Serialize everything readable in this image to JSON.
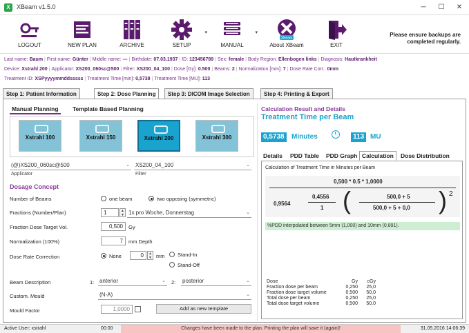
{
  "window": {
    "title": "XBeam v1.5.0",
    "app_icon": "X",
    "minimize": "─",
    "maximize": "☐",
    "close": "✕"
  },
  "toolbar": {
    "items": [
      {
        "label": "LOGOUT",
        "icon": "key-icon"
      },
      {
        "label": "NEW PLAN",
        "icon": "new-plan-icon"
      },
      {
        "label": "ARCHIVE",
        "icon": "archive-icon"
      },
      {
        "label": "SETUP",
        "icon": "gear-icon"
      },
      {
        "label": "MANUAL",
        "icon": "book-icon"
      },
      {
        "label": "About XBeam",
        "icon": "xbeam-logo-icon",
        "logo_text": "XBeam"
      },
      {
        "label": "EXIT",
        "icon": "exit-icon"
      }
    ],
    "backup_note": "Please ensure backups are completed regularly."
  },
  "patient_info": {
    "row1": [
      {
        "k": "Last name:",
        "v": "Baum"
      },
      {
        "k": "First name:",
        "v": "Günter"
      },
      {
        "k": "Middle name:",
        "v": "---"
      },
      {
        "k": "Birthdate:",
        "v": "07.03.1937"
      },
      {
        "k": "ID:",
        "v": "123456789"
      },
      {
        "k": "Sex:",
        "v": "female"
      },
      {
        "k": "Body Region:",
        "v": "Ellenbogen links"
      },
      {
        "k": "Diagnosis:",
        "v": "Hautkrankheit"
      }
    ],
    "row2": [
      {
        "k": "Device:",
        "v": "Xstrahl 200"
      },
      {
        "k": "Applicator:",
        "v": "XS200_060sc@500"
      },
      {
        "k": "Filter:",
        "v": "XS200_04_100"
      },
      {
        "k": "Dose [Gy]:",
        "v": "0.500"
      },
      {
        "k": "Beams:",
        "v": "2"
      },
      {
        "k": "Normalization [mm]:",
        "v": "7"
      },
      {
        "k": "Dose Rate Corr.:",
        "v": "0mm"
      }
    ],
    "row3": [
      {
        "k": "Treatment ID:",
        "v": "XSPyyyymmddsssss"
      },
      {
        "k": "Treatment Time [min]:",
        "v": "0,5738"
      },
      {
        "k": "Treatment Time [MU]:",
        "v": "113"
      }
    ]
  },
  "steps": [
    {
      "label": "Step 1: Patient Information"
    },
    {
      "label": "Step 2: Dose Planning"
    },
    {
      "label": "Step 3: DICOM Image Selection"
    },
    {
      "label": "Step 4: Printing & Export"
    }
  ],
  "planning_tabs": [
    {
      "label": "Manual Planning"
    },
    {
      "label": "Template Based Planning"
    }
  ],
  "machines": [
    {
      "label": "Xstrahl 100"
    },
    {
      "label": "Xstrahl 150"
    },
    {
      "label": "Xstrahl 200"
    },
    {
      "label": "Xstrahl 300"
    }
  ],
  "applicator": {
    "value": "(@)XS200_060sc@500",
    "label": "Applicator"
  },
  "filter": {
    "value": "XS200_04_100",
    "label": "Filter"
  },
  "dose_concept": {
    "title": "Dosage Concept",
    "beams_label": "Number of Beams",
    "beam_opt1": "one beam",
    "beam_opt2": "two opposing (symmetric)",
    "fractions_label": "Fractions (Number/Plan)",
    "fractions_value": "1",
    "fractions_schedule": "1x pro Woche, Donnerstag",
    "fraction_dose_label": "Fraction Dose Target Vol.",
    "fraction_dose_value": "0,500",
    "fraction_dose_unit": "Gy",
    "normalization_label": "Normalization (100%)",
    "normalization_value": "7",
    "normalization_unit": "mm Depth",
    "dose_rate_label": "Dose Rate Correction",
    "dose_rate_none": "None",
    "dose_rate_value": "0",
    "dose_rate_unit": "mm",
    "stand_in": "Stand-In",
    "stand_off": "Stand-Off",
    "beam_desc_label": "Beam Description",
    "beam1_num": "1:",
    "beam1_value": "anterior",
    "beam2_num": "2:",
    "beam2_value": "posterior",
    "custom_mould_label": "Custom. Mould",
    "custom_mould_value": "(N-A)",
    "mould_factor_label": "Mould Factor",
    "mould_factor_value": "1,0000",
    "add_template": "Add as new template"
  },
  "calc": {
    "head": "Calculation Result and Details",
    "title": "Treatment Time per Beam",
    "minutes_value": "0,5738",
    "minutes_unit": "Minutes",
    "mu_value": "113",
    "mu_unit": "MU",
    "tabs": [
      {
        "label": "Details"
      },
      {
        "label": "PDD Table"
      },
      {
        "label": "PDD Graph"
      },
      {
        "label": "Calculation"
      },
      {
        "label": "Dose Distribution"
      }
    ],
    "calc_caption": "Calculation of Treatment Time in Minutes per Beam",
    "f_numerator": "0,500 * 0.5 * 1,0000",
    "f_a": "0,9564",
    "f_b_num": "0,4556",
    "f_b_den": "1",
    "f_c_num": "500,0 + 5",
    "f_c_den": "500,0 + 5 + 0,0",
    "f_exp": "2",
    "note": "%PDD interpolated between 5mm (1,000) and 10mm (0,891).",
    "dose_table": {
      "header": {
        "c1": "Dose",
        "c2": "Gy",
        "c3": "cGy"
      },
      "rows": [
        {
          "c1": "Fraction dose per beam",
          "c2": "0,250",
          "c3": "25,0"
        },
        {
          "c1": "Fraction dose target volume",
          "c2": "0,500",
          "c3": "50,0"
        },
        {
          "c1": "Total dose per beam",
          "c2": "0,250",
          "c3": "25,0"
        },
        {
          "c1": "Total dose target volume",
          "c2": "0,500",
          "c3": "50,0"
        }
      ]
    }
  },
  "status": {
    "user": "Active User: xstrahl",
    "time": "00:00",
    "message": "Changes have been made to the plan. Printing the plan will save it (again)!",
    "datetime": "31.05.2016 14:06:39"
  },
  "colors": {
    "accent": "#1ba3cf",
    "purple": "#8a3b9c",
    "warn": "#f7c3c3",
    "ok": "#cdeed0"
  }
}
